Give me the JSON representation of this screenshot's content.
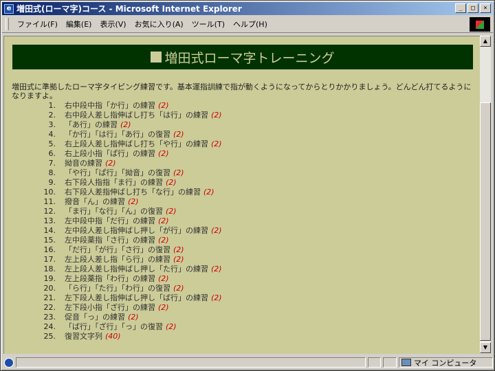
{
  "window": {
    "title": "増田式(ローマ字)コース - Microsoft Internet Explorer"
  },
  "window_buttons": [
    "_",
    "□",
    "×"
  ],
  "menu": [
    "ファイル(F)",
    "編集(E)",
    "表示(V)",
    "お気に入り(A)",
    "ツール(T)",
    "ヘルプ(H)"
  ],
  "page": {
    "heading": "増田式ローマ字トレーニング",
    "intro": "増田式に準拠したローマ字タイピング練習です。基本運指訓練で指が動くようになってからとりかかりましょう。どんどん打てるようになりますよ。",
    "lessons": [
      {
        "num": "1.",
        "title": "右中段中指「か行」の練習",
        "count": "(2)"
      },
      {
        "num": "2.",
        "title": "右中段人差し指伸ばし打ち「は行」の練習",
        "count": "(2)"
      },
      {
        "num": "3.",
        "title": "「あ行」の練習",
        "count": "(2)"
      },
      {
        "num": "4.",
        "title": "「か行」「は行」「あ行」の復習",
        "count": "(2)"
      },
      {
        "num": "5.",
        "title": "右上段人差し指伸ばし打ち「や行」の練習",
        "count": "(2)"
      },
      {
        "num": "6.",
        "title": "右上段小指「ぱ行」の練習",
        "count": "(2)"
      },
      {
        "num": "7.",
        "title": "拗音の練習",
        "count": "(2)"
      },
      {
        "num": "8.",
        "title": "「や行」「ぱ行」「拗音」の復習",
        "count": "(2)"
      },
      {
        "num": "9.",
        "title": "右下段人指指「ま行」の練習",
        "count": "(2)"
      },
      {
        "num": "10.",
        "title": "右下段人差指伸ばし打ち「な行」の練習",
        "count": "(2)"
      },
      {
        "num": "11.",
        "title": "撥音「ん」の練習",
        "count": "(2)"
      },
      {
        "num": "12.",
        "title": "「ま行」「な行」「ん」の復習",
        "count": "(2)"
      },
      {
        "num": "13.",
        "title": "左中段中指「だ行」の練習",
        "count": "(2)"
      },
      {
        "num": "14.",
        "title": "左中段人差し指伸ばし押し「が行」の練習",
        "count": "(2)"
      },
      {
        "num": "15.",
        "title": "左中段薬指「さ行」の練習",
        "count": "(2)"
      },
      {
        "num": "16.",
        "title": "「だ行」「が行」「さ行」の復習",
        "count": "(2)"
      },
      {
        "num": "17.",
        "title": "左上段人差し指「ら行」の練習",
        "count": "(2)"
      },
      {
        "num": "18.",
        "title": "左上段人差し指伸ばし押し「た行」の練習",
        "count": "(2)"
      },
      {
        "num": "19.",
        "title": "左上段薬指「わ行」の練習",
        "count": "(2)"
      },
      {
        "num": "20.",
        "title": "「ら行」「た行」「わ行」の復習",
        "count": "(2)"
      },
      {
        "num": "21.",
        "title": "左下段人差し指伸ばし押し「ば行」の練習",
        "count": "(2)"
      },
      {
        "num": "22.",
        "title": "左下段小指「ざ行」の練習",
        "count": "(2)"
      },
      {
        "num": "23.",
        "title": "促音「っ」の練習",
        "count": "(2)"
      },
      {
        "num": "24.",
        "title": "「ば行」「ざ行」「っ」の復習",
        "count": "(2)"
      },
      {
        "num": "25.",
        "title": "復習文字列",
        "count": "(40)"
      }
    ]
  },
  "scrollbar": {
    "up": "▲",
    "down": "▼"
  },
  "status": {
    "zone": "マイ コンピュータ"
  },
  "colors": {
    "page_bg": "#cccc99",
    "banner_bg": "#003300",
    "count_color": "#cc0000"
  }
}
